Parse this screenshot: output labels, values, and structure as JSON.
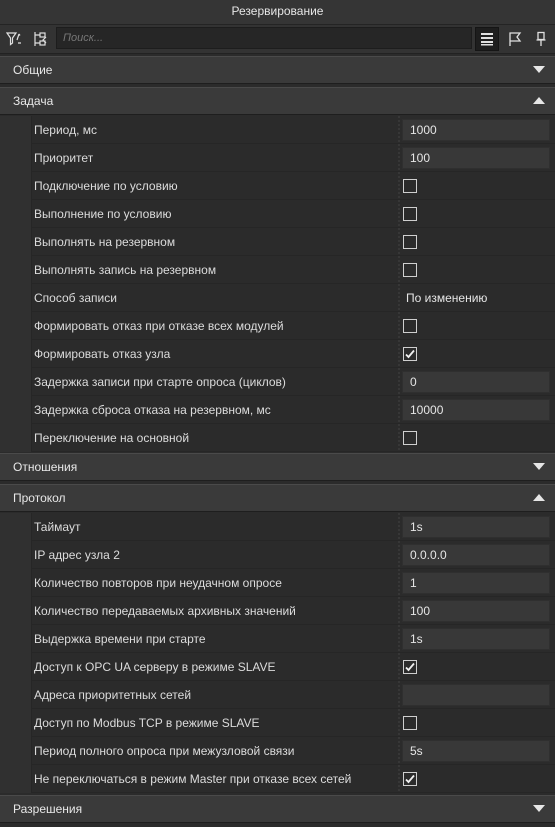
{
  "window": {
    "title": "Резервирование"
  },
  "toolbar": {
    "search_placeholder": "Поиск...",
    "icons": [
      "filter-icon",
      "expand-tree-icon",
      "list-view-icon",
      "flag-icon",
      "pin-icon"
    ]
  },
  "sections": {
    "general": {
      "label": "Общие",
      "expanded": false
    },
    "task": {
      "label": "Задача",
      "expanded": true,
      "rows": [
        {
          "label": "Период, мс",
          "type": "input",
          "value": "1000"
        },
        {
          "label": "Приоритет",
          "type": "input",
          "value": "100"
        },
        {
          "label": "Подключение по условию",
          "type": "checkbox",
          "checked": false
        },
        {
          "label": "Выполнение по условию",
          "type": "checkbox",
          "checked": false
        },
        {
          "label": "Выполнять на резервном",
          "type": "checkbox",
          "checked": false
        },
        {
          "label": "Выполнять запись на резервном",
          "type": "checkbox",
          "checked": false
        },
        {
          "label": "Способ записи",
          "type": "text",
          "value": "По изменению"
        },
        {
          "label": "Формировать отказ при отказе всех модулей",
          "type": "checkbox",
          "checked": false
        },
        {
          "label": "Формировать отказ узла",
          "type": "checkbox",
          "checked": true
        },
        {
          "label": "Задержка записи при старте опроса (циклов)",
          "type": "input",
          "value": "0"
        },
        {
          "label": "Задержка сброса отказа на резервном, мс",
          "type": "input",
          "value": "10000"
        },
        {
          "label": "Переключение на основной",
          "type": "checkbox",
          "checked": false
        }
      ]
    },
    "relations": {
      "label": "Отношения",
      "expanded": false
    },
    "protocol": {
      "label": "Протокол",
      "expanded": true,
      "rows": [
        {
          "label": "Таймаут",
          "type": "input",
          "value": "1s"
        },
        {
          "label": "IP адрес узла 2",
          "type": "input",
          "value": "0.0.0.0"
        },
        {
          "label": "Количество повторов при неудачном опросе",
          "type": "input",
          "value": "1"
        },
        {
          "label": "Количество передаваемых архивных значений",
          "type": "input",
          "value": "100"
        },
        {
          "label": "Выдержка времени при старте",
          "type": "input",
          "value": "1s"
        },
        {
          "label": "Доступ к OPC UA серверу в режиме SLAVE",
          "type": "checkbox",
          "checked": true
        },
        {
          "label": "Адреса приоритетных сетей",
          "type": "input",
          "value": ""
        },
        {
          "label": "Доступ по Modbus TCP в режиме SLAVE",
          "type": "checkbox",
          "checked": false
        },
        {
          "label": "Период полного опроса при межузловой связи",
          "type": "input",
          "value": "5s"
        },
        {
          "label": "Не переключаться в режим Master при отказе всех сетей",
          "type": "checkbox",
          "checked": true
        }
      ]
    },
    "permissions": {
      "label": "Разрешения",
      "expanded": false
    }
  }
}
